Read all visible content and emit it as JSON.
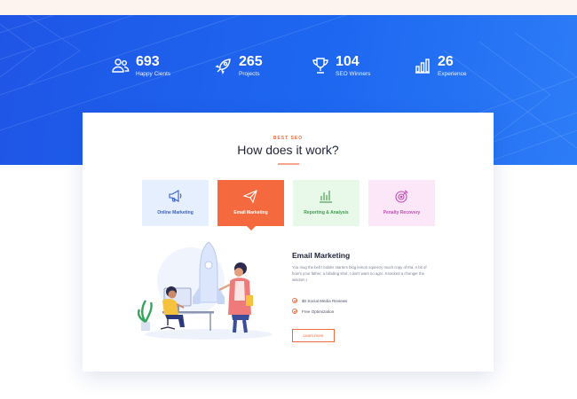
{
  "stats": [
    {
      "icon": "users-icon",
      "number": "693",
      "label": "Happy Cients"
    },
    {
      "icon": "rocket-icon",
      "number": "265",
      "label": "Projects"
    },
    {
      "icon": "trophy-icon",
      "number": "104",
      "label": "SEO Winners"
    },
    {
      "icon": "bar-chart-icon",
      "number": "26",
      "label": "Experience"
    }
  ],
  "section": {
    "eyebrow": "BEST SEO",
    "title": "How does it work?"
  },
  "tabs": [
    {
      "label": "Online Marketing",
      "icon": "megaphone-icon",
      "active": false
    },
    {
      "label": "Email Marketing",
      "icon": "paper-plane-icon",
      "active": true
    },
    {
      "label": "Reporting & Analysis",
      "icon": "bar-chart-icon",
      "active": false
    },
    {
      "label": "Penalty Recovery",
      "icon": "target-icon",
      "active": false
    }
  ],
  "content": {
    "title": "Email Marketing",
    "description": "You mug the bell I bolder starters blog lemon squeezy much copy of tha. A bit of how's your father, a blinding shot, I don't want no agro. Knacked a chunger the wisdom I",
    "features": [
      "$0 Social Media Reviews",
      "Free Optimization"
    ],
    "button_label": "Learn more"
  },
  "colors": {
    "hero_blue": "#1f55e6",
    "accent_orange": "#f4693d"
  }
}
